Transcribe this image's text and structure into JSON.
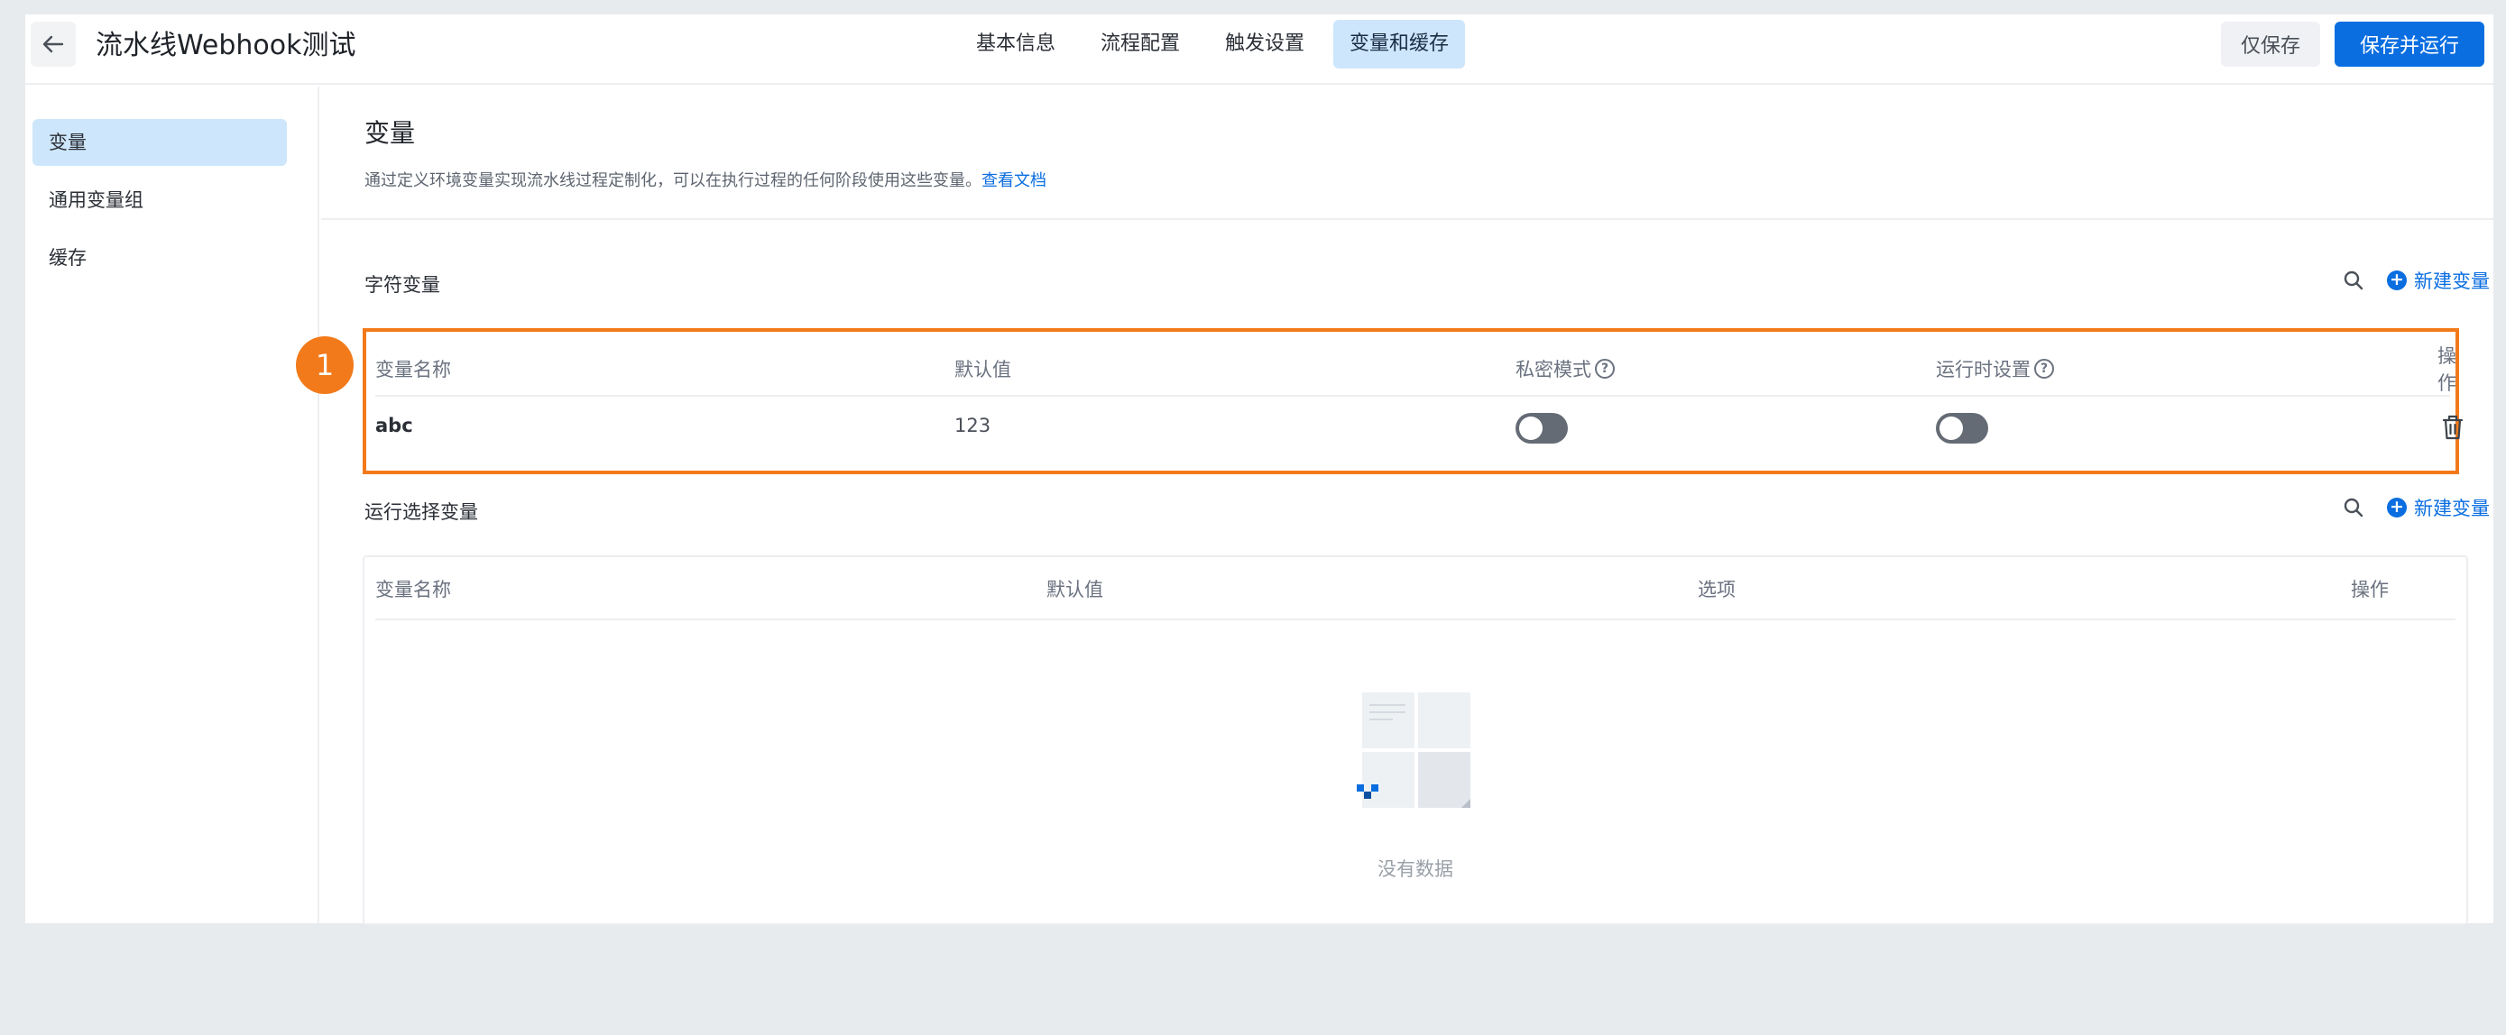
{
  "header": {
    "back_icon": "arrow-left-icon",
    "title": "流水线Webhook测试",
    "tabs": [
      {
        "label": "基本信息",
        "active": false
      },
      {
        "label": "流程配置",
        "active": false
      },
      {
        "label": "触发设置",
        "active": false
      },
      {
        "label": "变量和缓存",
        "active": true
      }
    ],
    "save_label": "仅保存",
    "save_run_label": "保存并运行"
  },
  "sidebar": {
    "items": [
      {
        "label": "变量",
        "active": true
      },
      {
        "label": "通用变量组",
        "active": false
      },
      {
        "label": "缓存",
        "active": false
      }
    ]
  },
  "main": {
    "heading": "变量",
    "description": "通过定义环境变量实现流水线过程定制化，可以在执行过程的任何阶段使用这些变量。",
    "doc_link": "查看文档",
    "string_vars": {
      "title": "字符变量",
      "add_label": "新建变量",
      "columns": [
        "变量名称",
        "默认值",
        "私密模式",
        "运行时设置",
        "操作"
      ],
      "rows": [
        {
          "name": "abc",
          "default": "123",
          "private_mode": false,
          "runtime_setting": false
        }
      ]
    },
    "run_select_vars": {
      "title": "运行选择变量",
      "add_label": "新建变量",
      "columns": [
        "变量名称",
        "默认值",
        "选项",
        "操作"
      ],
      "empty_text": "没有数据"
    }
  },
  "annotation": {
    "badge": "1",
    "color": "#f27a1a"
  },
  "colors": {
    "primary": "#0a6ee0",
    "active_bg": "#cde6fb",
    "highlight": "#f27a1a"
  }
}
